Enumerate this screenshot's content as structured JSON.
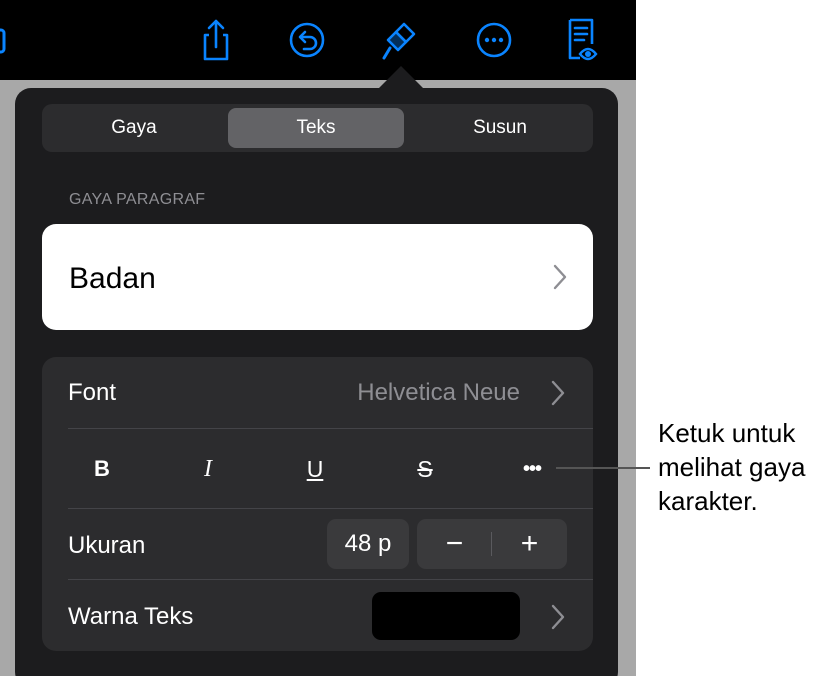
{
  "toolbar": {
    "icons": [
      "photo-icon",
      "share-icon",
      "undo-icon",
      "format-brush-icon",
      "more-icon",
      "reader-view-icon"
    ],
    "accent_color": "#0a84ff"
  },
  "tabs": [
    {
      "label": "Gaya",
      "active": false
    },
    {
      "label": "Teks",
      "active": true
    },
    {
      "label": "Susun",
      "active": false
    }
  ],
  "paragraph_style": {
    "section_label": "GAYA PARAGRAF",
    "value": "Badan"
  },
  "font_row": {
    "label": "Font",
    "value": "Helvetica Neue"
  },
  "format_buttons": [
    "B",
    "I",
    "U",
    "S",
    "•••"
  ],
  "size_row": {
    "label": "Ukuran",
    "value": "48 p",
    "decrease": "−",
    "increase": "+"
  },
  "color_row": {
    "label": "Warna Teks",
    "swatch_color": "#000000"
  },
  "callout": {
    "line1": "Ketuk untuk",
    "line2": "melihat gaya",
    "line3": "karakter."
  }
}
